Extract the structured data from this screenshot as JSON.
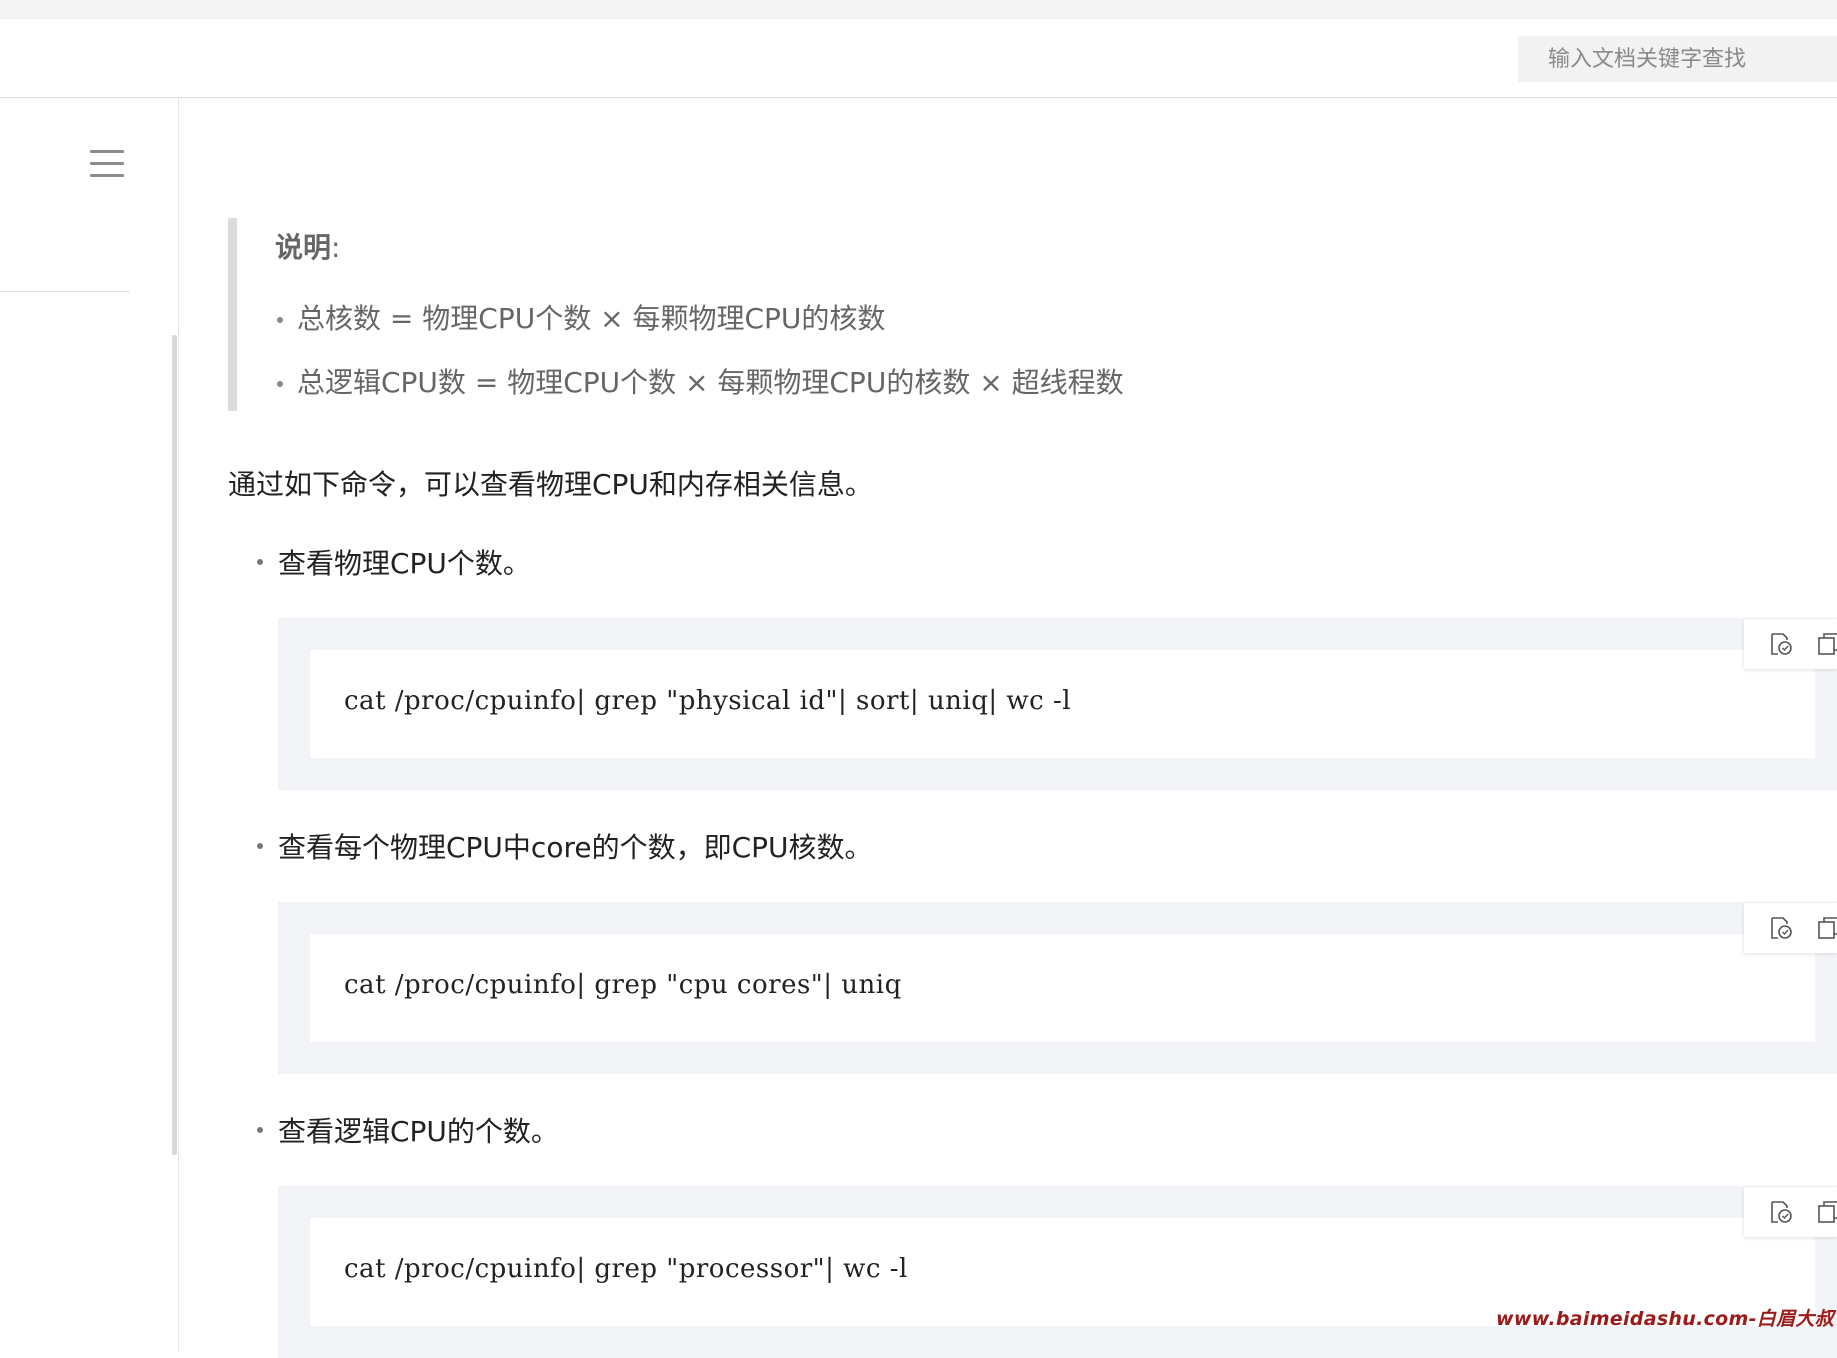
{
  "header": {
    "search_placeholder": "输入文档关键字查找"
  },
  "note": {
    "title": "说明",
    "title_colon": ":",
    "items": [
      "总核数 = 物理CPU个数 × 每颗物理CPU的核数",
      "总逻辑CPU数 = 物理CPU个数 × 每颗物理CPU的核数 × 超线程数"
    ]
  },
  "intro": "通过如下命令，可以查看物理CPU和内存相关信息。",
  "steps": [
    {
      "label": "查看物理CPU个数。",
      "code": "cat /proc/cpuinfo| grep \"physical id\"| sort| uniq| wc -l"
    },
    {
      "label": "查看每个物理CPU中core的个数，即CPU核数。",
      "code": "cat /proc/cpuinfo| grep \"cpu cores\"| uniq"
    },
    {
      "label": "查看逻辑CPU的个数。",
      "code": "cat /proc/cpuinfo| grep \"processor\"| wc -l"
    }
  ],
  "watermark": "www.baimeidashu.com-白眉大叔",
  "icons": {
    "menu": "hamburger-menu-icon",
    "copy": "copy-icon",
    "copy_alt": "duplicate-icon"
  }
}
